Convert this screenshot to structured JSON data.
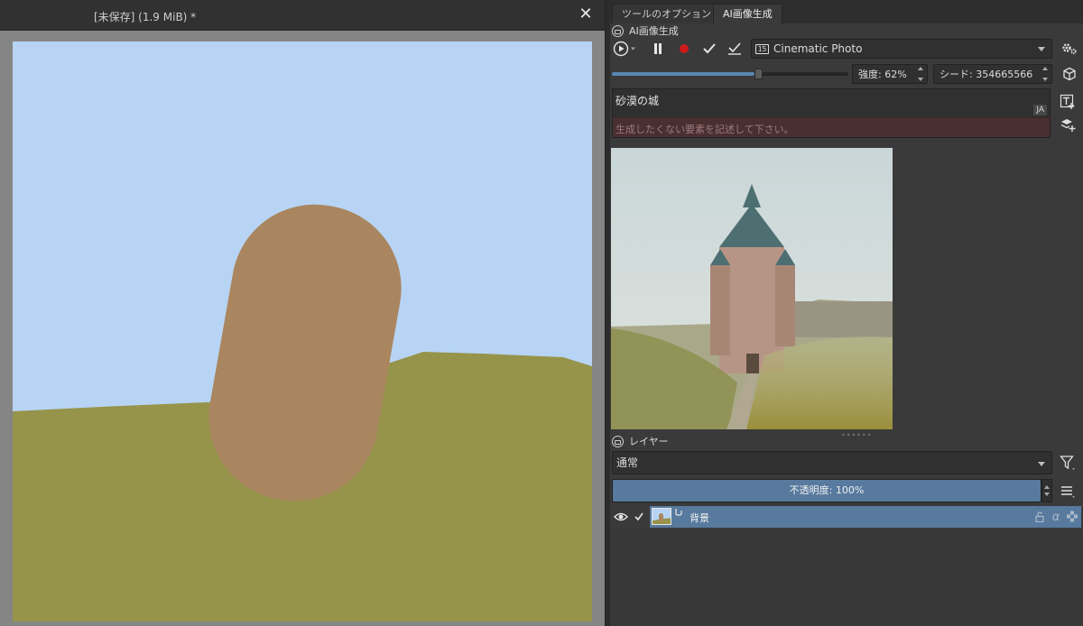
{
  "document": {
    "title": "[未保存]  (1.9 MiB) *",
    "close_glyph": "✕",
    "colors": {
      "sky": "#b8d4f5",
      "ground": "#96944b",
      "shape": "#a9865f"
    }
  },
  "tabs": [
    {
      "label": "ツールのオプション",
      "active": false
    },
    {
      "label": "AI画像生成",
      "active": true
    }
  ],
  "ai_panel": {
    "section_title": "AI画像生成",
    "style_preset": "Cinematic Photo",
    "style_badge": "15",
    "strength": {
      "label": "強度: 62%",
      "value": 0.62
    },
    "seed": {
      "label": "シード: 354665566"
    },
    "prompt": "砂漠の城",
    "prompt_language": "JA",
    "negative_prompt_placeholder": "生成したくない要素を記述して下さい。",
    "grip": "••••••"
  },
  "layers_panel": {
    "section_title": "レイヤー",
    "blend_mode": "通常",
    "opacity": {
      "label": "不透明度:  100%",
      "value": 1.0
    },
    "layers": [
      {
        "name": "背景",
        "visible": true,
        "checked": true
      }
    ]
  },
  "icons": {
    "play": "play-icon",
    "pause": "pause-icon",
    "record": "record-icon",
    "check": "check-icon",
    "check_all": "check-all-icon",
    "settings": "settings-icon",
    "cube": "cube-icon",
    "add_text": "add-text-icon",
    "add_layer": "add-layer-icon",
    "filter": "filter-icon",
    "menu": "menu-icon",
    "eye": "eye-icon",
    "lock": "lock-icon",
    "alpha": "alpha-icon",
    "inherit": "inherit-icon"
  },
  "accent_color": "#587a9e"
}
